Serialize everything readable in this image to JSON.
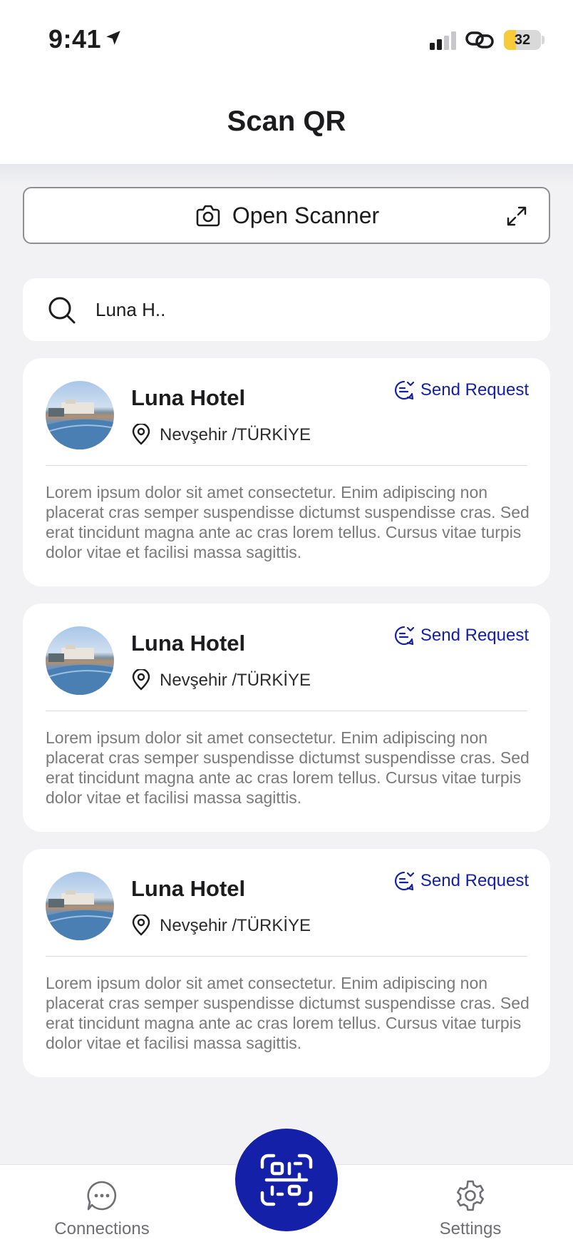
{
  "status_bar": {
    "time": "9:41",
    "battery_level": "32",
    "battery_fraction": 0.32
  },
  "header": {
    "title": "Scan QR"
  },
  "scanner": {
    "label": "Open Scanner"
  },
  "search": {
    "value": "Luna H..",
    "placeholder": ""
  },
  "cards": [
    {
      "name": "Luna Hotel",
      "location": "Nevşehir /TÜRKİYE",
      "action_label": "Send Request",
      "description": "Lorem ipsum dolor sit amet consectetur. Enim adipiscing non placerat cras semper suspendisse dictumst suspendisse cras. Sed erat tincidunt magna ante ac cras lorem tellus. Cursus vitae turpis dolor vitae et facilisi massa sagittis."
    },
    {
      "name": "Luna Hotel",
      "location": "Nevşehir /TÜRKİYE",
      "action_label": "Send Request",
      "description": "Lorem ipsum dolor sit amet consectetur. Enim adipiscing non placerat cras semper suspendisse dictumst suspendisse cras. Sed erat tincidunt magna ante ac cras lorem tellus. Cursus vitae turpis dolor vitae et facilisi massa sagittis."
    },
    {
      "name": "Luna Hotel",
      "location": "Nevşehir /TÜRKİYE",
      "action_label": "Send Request",
      "description": "Lorem ipsum dolor sit amet consectetur. Enim adipiscing non placerat cras semper suspendisse dictumst suspendisse cras. Sed erat tincidunt magna ante ac cras lorem tellus. Cursus vitae turpis dolor vitae et facilisi massa sagittis."
    }
  ],
  "bottom_nav": {
    "connections_label": "Connections",
    "settings_label": "Settings",
    "center_icon": "qr-scan-icon"
  },
  "colors": {
    "accent": "#1420a8",
    "background": "#f2f2f4",
    "battery": "#f7cc3a"
  }
}
